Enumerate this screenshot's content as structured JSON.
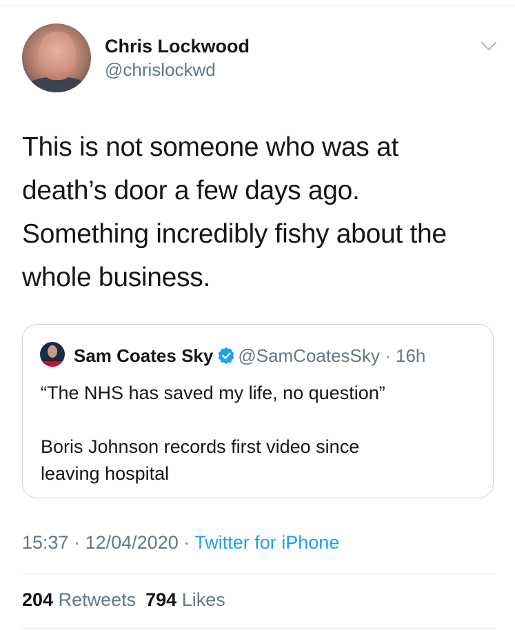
{
  "tweet": {
    "author": {
      "name": "Chris Lockwood",
      "handle": "@chrislockwd",
      "avatar_icon": "profile-photo"
    },
    "text_lines": [
      "This is not someone who was at",
      "death’s door a few days ago.",
      "Something incredibly fishy about the",
      "whole business."
    ],
    "menu_icon": "chevron-down-icon",
    "quoted": {
      "name": "Sam Coates Sky",
      "verified": true,
      "handle": "@SamCoatesSky",
      "separator": " · ",
      "time": "16h",
      "lines": [
        "“The NHS has saved my life, no question”",
        "",
        "Boris Johnson records first video since",
        "leaving hospital"
      ]
    },
    "meta": {
      "time": "15:37",
      "separator": " · ",
      "date": "12/04/2020",
      "source": "Twitter for iPhone"
    },
    "stats": {
      "retweets_count": "204",
      "retweets_label": "Retweets",
      "likes_count": "794",
      "likes_label": "Likes"
    }
  },
  "colors": {
    "text": "#14171a",
    "muted": "#657786",
    "link": "#1da1f2",
    "border": "#ccd6dd",
    "divider": "#e1e8ed"
  }
}
